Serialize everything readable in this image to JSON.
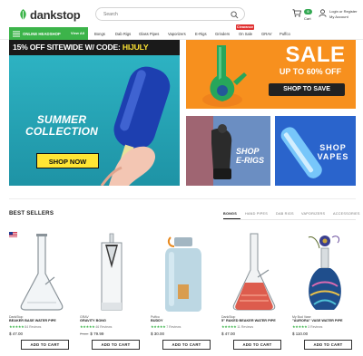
{
  "header": {
    "logo_text": "dankstop",
    "search_placeholder": "Search",
    "cart_count": "0",
    "cart_label": "Cart",
    "account_line1": "Login or Register",
    "account_line2": "My Account"
  },
  "nav": {
    "headshop_label": "ONLINE HEADSHOP",
    "headshop_viewall": "View All",
    "items": [
      "Bongs",
      "Dab Rigs",
      "Glass Pipes",
      "Vaporizers",
      "E-Rigs",
      "Grinders",
      "On Sale",
      "GRAV",
      "Puffco"
    ],
    "onsale_badge": "Clearance"
  },
  "banners": {
    "promo_text": "15% OFF SITEWIDE W/ CODE: ",
    "promo_code": "HIJULY",
    "summer_line1": "SUMMER",
    "summer_line2": "COLLECTION",
    "shop_now": "SHOP NOW",
    "sale_title": "SALE",
    "sale_sub": "UP TO 60% OFF",
    "shop_to_save": "SHOP TO SAVE",
    "erigs_line1": "SHOP",
    "erigs_line2": "E-RIGS",
    "vapes_line1": "SHOP",
    "vapes_line2": "VAPES"
  },
  "best_sellers": {
    "title": "BEST SELLERS",
    "tabs": [
      "BONGS",
      "HAND PIPES",
      "DAB RIGS",
      "VAPORIZERS",
      "ACCESSORIES"
    ],
    "active_tab": "BONGS",
    "products": [
      {
        "brand": "DankStop",
        "name": "BEAKER BASE WATER PIPE",
        "stars": "★★★★★",
        "reviews": "84 Reviews",
        "old_price": "",
        "price": "$ 47.00",
        "button": "ADD TO CART"
      },
      {
        "brand": "GRAV",
        "name": "GRAVITY BONG",
        "stars": "★★★★★",
        "reviews": "46 Reviews",
        "old_price": "From",
        "price": "$ 79.99",
        "button": "ADD TO CART"
      },
      {
        "brand": "Puffco",
        "name": "BUDDY",
        "stars": "★★★★★",
        "reviews": "7 Reviews",
        "old_price": "",
        "price": "$ 30.00",
        "button": "ADD TO CART"
      },
      {
        "brand": "DankStop",
        "name": "5\" RAKED BEAKER WATER PIPE",
        "stars": "★★★★★",
        "reviews": "11 Reviews",
        "old_price": "",
        "price": "$ 47.00",
        "button": "ADD TO CART"
      },
      {
        "brand": "My Bud Vase",
        "name": "\"AURORA\" VASE WATER PIPE",
        "stars": "★★★★★",
        "reviews": "3 Reviews",
        "old_price": "",
        "price": "$ 110.00",
        "button": "ADD TO CART"
      }
    ]
  },
  "colors": {
    "brand_green": "#3cb44a",
    "promo_yellow": "#ffe534",
    "sale_orange": "#f7901e",
    "teal": "#2fb6c6"
  }
}
